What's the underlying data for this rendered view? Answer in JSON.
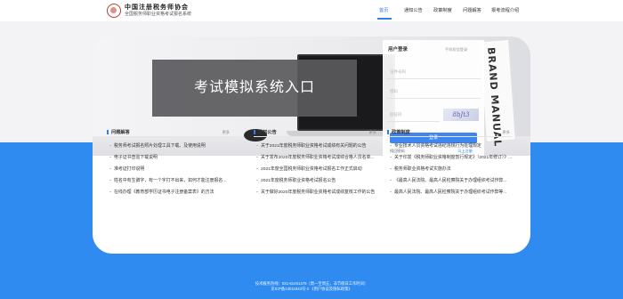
{
  "header": {
    "brand_title": "中国注册税务师协会",
    "brand_subtitle": "全国税务师职业资格考试报名系统",
    "nav": [
      {
        "label": "首页",
        "active": true
      },
      {
        "label": "通知公告",
        "active": false
      },
      {
        "label": "政策制度",
        "active": false
      },
      {
        "label": "问题解答",
        "active": false
      },
      {
        "label": "报考流程介绍",
        "active": false
      }
    ]
  },
  "banner": {
    "title": "考试模拟系统入口",
    "book_text": "BRAND MANUAL"
  },
  "login": {
    "title": "用户登录",
    "alt_link": "手机短信登录",
    "username_placeholder": "证件号码",
    "password_placeholder": "密码",
    "captcha_placeholder": "验证码",
    "captcha_text": "8bJt3",
    "submit": "登录",
    "forgot": "找回密码",
    "register": "马上注册"
  },
  "columns": [
    {
      "title": "问题解答",
      "more": "更多",
      "items": [
        "税务师考试报名照片处理工具下载、及使用说明",
        "电子证书查验下载说明",
        "准考证打印说明",
        "姓名中有生僻字，有一个字打不出来，如何才能注册报名...",
        "在线办理《教育部学历证书电子注册备案表》的方法"
      ]
    },
    {
      "title": "通知公告",
      "more": "更多",
      "items": [
        "关于2021年度税务师职业资格考试成绩有关问题的公告",
        "关于发布2020年度税务师职业资格考试成绩合格人员名单...",
        "2021年度全国税务师职业资格考试报名工作正式启动",
        "2021年度税务师职业资格考试报名公告",
        "关于做好2020年度税务师职业资格考试成绩复核工作的公告"
      ]
    },
    {
      "title": "政策制度",
      "more": "更多",
      "items": [
        "专业技术人员资格考试违纪违规行为处理规定",
        "关于印发《税务师职业资格制度暂行规定》（2021年修订）》...",
        "税务师职业资格考试实施办法",
        "《最高人民法院、最高人民检察院关于办理组织考试作弊...",
        "最高人民法院、最高人民检察院关于办理组织考试作弊等..."
      ]
    }
  ],
  "footer": {
    "line1": "技术服务热线：021-61451475（周一至周五，非节假日工作时间）",
    "line2": "京ICP备13011943号-2  《用户协议及隐私政策》"
  }
}
